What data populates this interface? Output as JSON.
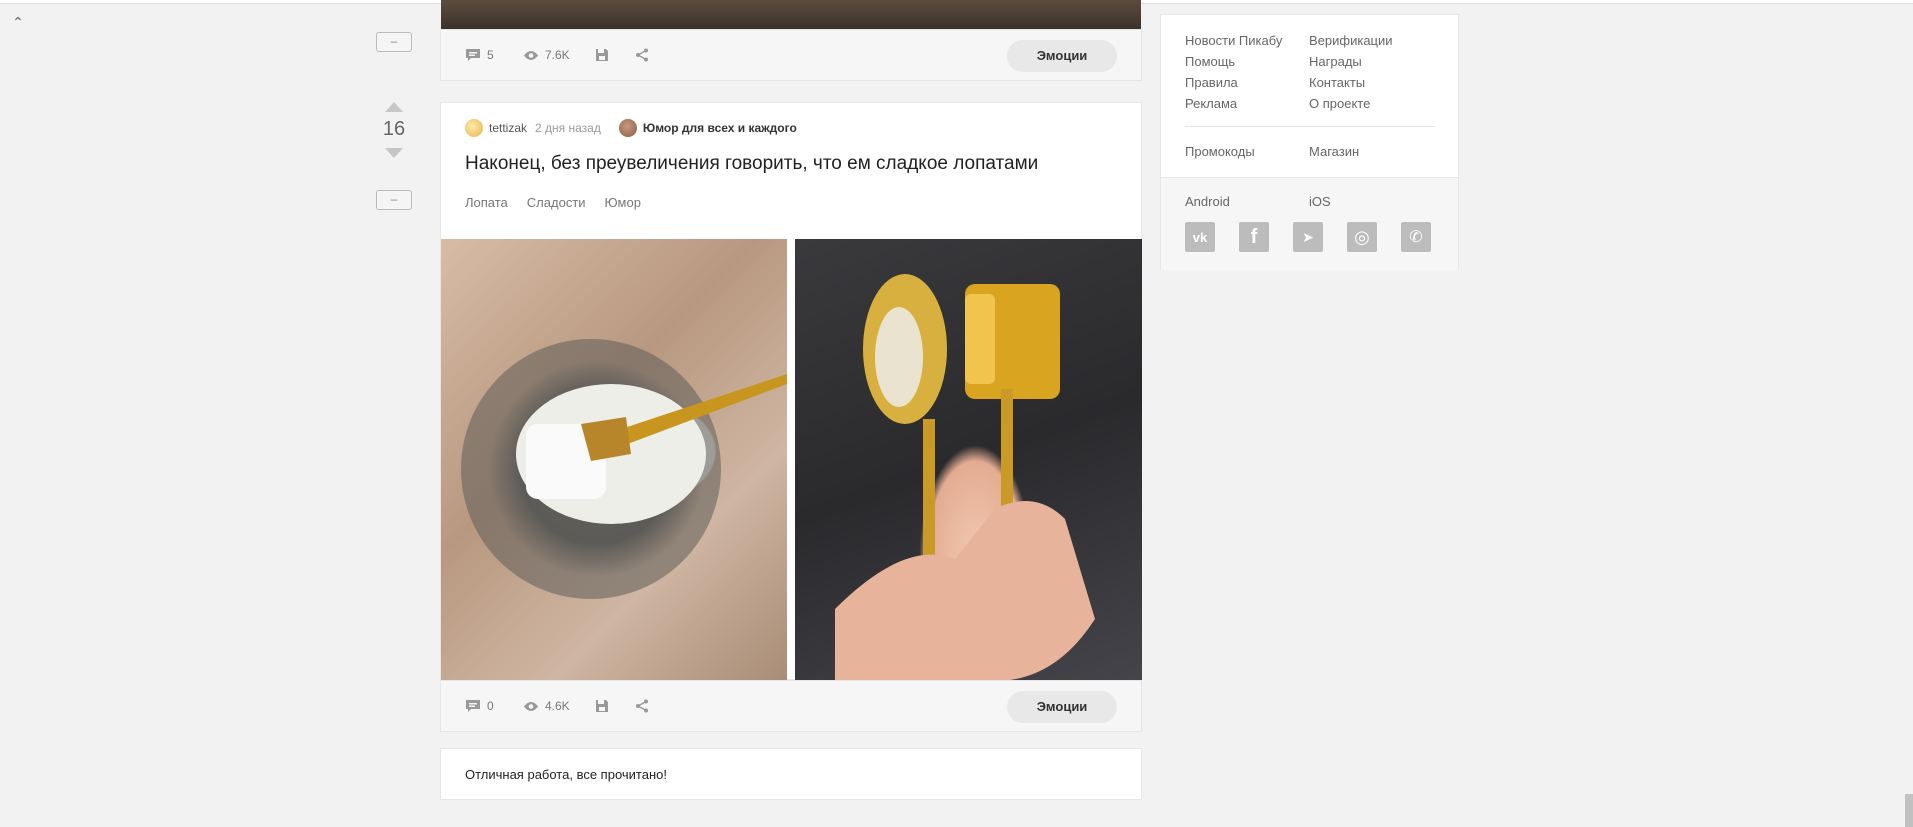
{
  "nav": {
    "scroll_up_icon": "⌃"
  },
  "prev_story": {
    "comments": "5",
    "views": "7.6K",
    "emotions_label": "Эмоции"
  },
  "story": {
    "rating": "16",
    "author": "tettizak",
    "time": "2 дня назад",
    "community": "Юмор для всех и каждого",
    "title": "Наконец, без преувеличения говорить, что ем сладкое лопатами",
    "tags": [
      "Лопата",
      "Сладости",
      "Юмор"
    ],
    "comments": "0",
    "views": "4.6K",
    "emotions_label": "Эмоции"
  },
  "collapse_label": "–",
  "end_message": "Отличная работа, все прочитано!",
  "sidebar": {
    "links": [
      "Новости Пикабу",
      "Верификации",
      "Помощь",
      "Награды",
      "Правила",
      "Контакты",
      "Реклама",
      "О проекте"
    ],
    "links2": [
      "Промокоды",
      "Магазин"
    ],
    "apps": [
      "Android",
      "iOS"
    ],
    "social": [
      {
        "name": "vk",
        "glyph": "vk"
      },
      {
        "name": "facebook",
        "glyph": "f"
      },
      {
        "name": "telegram",
        "glyph": "➤"
      },
      {
        "name": "instagram",
        "glyph": "◎"
      },
      {
        "name": "viber",
        "glyph": "✆"
      }
    ]
  }
}
